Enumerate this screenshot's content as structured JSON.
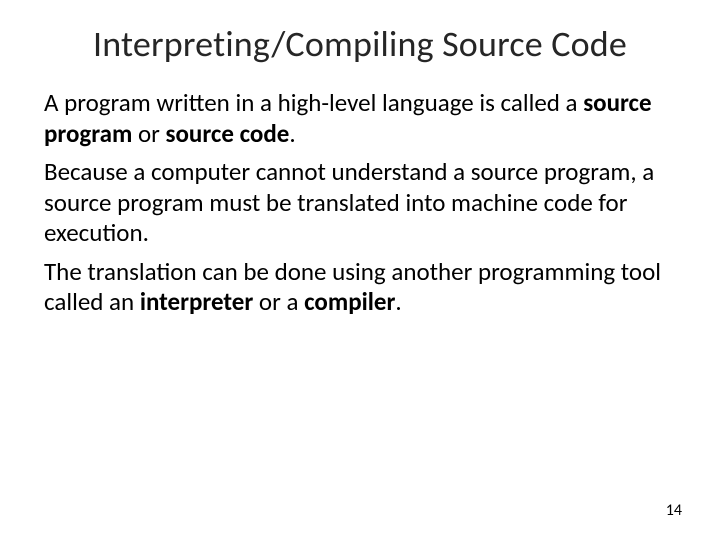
{
  "slide": {
    "title": "Interpreting/Compiling Source Code",
    "paragraphs": {
      "p1": {
        "t1": "A program written in a high-level language is called a ",
        "b1": "source program",
        "t2": " or ",
        "b2": "source code",
        "t3": "."
      },
      "p2": {
        "t1": "Because a computer cannot understand a source program, a source program must be translated into machine code for execution."
      },
      "p3": {
        "t1": "The translation can be done using another programming tool called an ",
        "b1": "interpreter",
        "t2": " or a ",
        "b2": "compiler",
        "t3": "."
      }
    },
    "page_number": "14"
  }
}
